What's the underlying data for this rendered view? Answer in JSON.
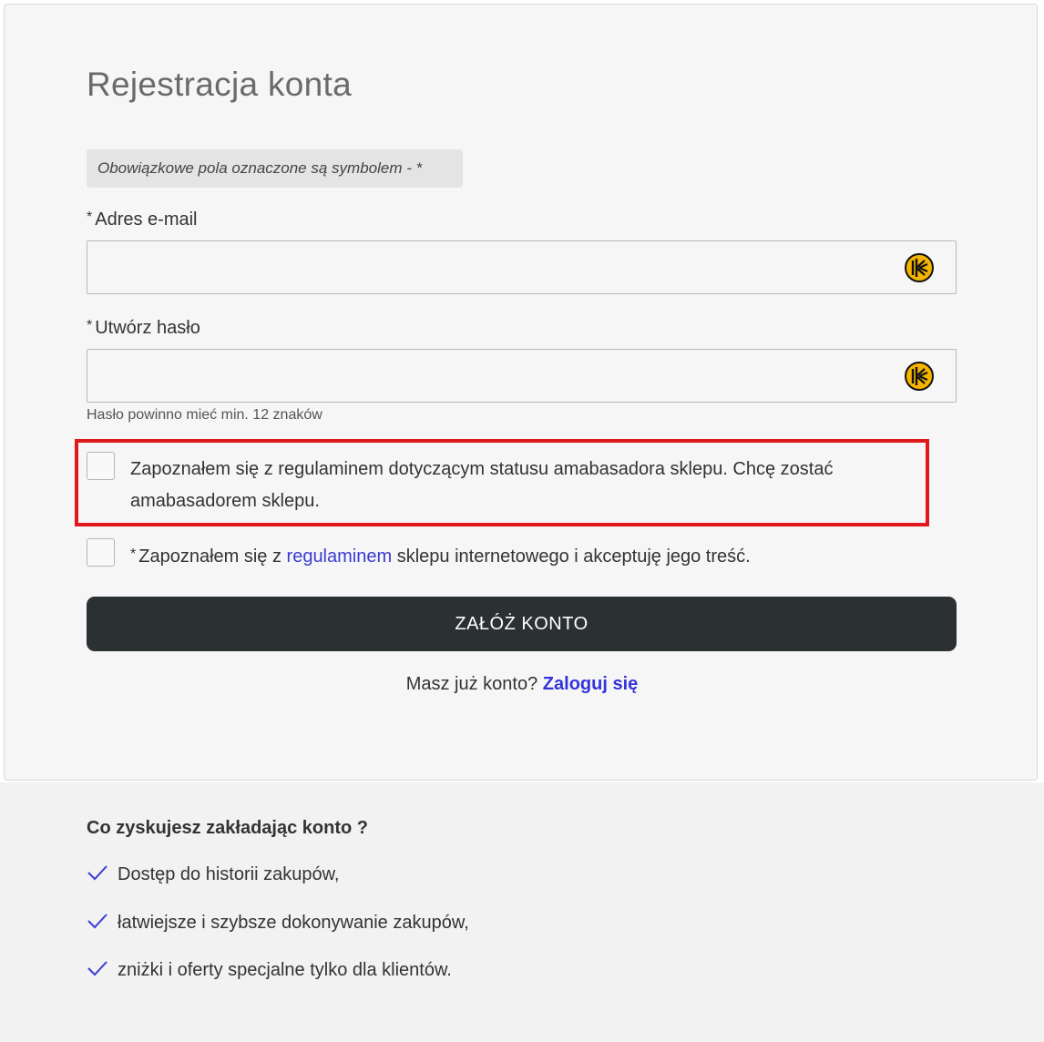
{
  "form": {
    "title": "Rejestracja konta",
    "notice": "Obowiązkowe pola oznaczone są symbolem - *",
    "required_mark": "*",
    "email_label": "Adres e-mail",
    "email_value": "",
    "password_label": "Utwórz hasło",
    "password_value": "",
    "password_hint": "Hasło powinno mieć min. 12 znaków",
    "ambassador_text": "Zapoznałem się z regulaminem dotyczącym statusu amabasadora sklepu. Chcę zostać amabasadorem sklepu.",
    "ambassador_checked": false,
    "terms_prefix": "Zapoznałem się z ",
    "terms_link": "regulaminem",
    "terms_suffix": " sklepu internetowego i akceptuję jego treść.",
    "terms_checked": false,
    "submit_label": "ZAŁÓŻ KONTO",
    "login_prompt": "Masz już konto?",
    "login_link": "Zaloguj się"
  },
  "benefits": {
    "title": "Co zyskujesz zakładając konto ?",
    "items": [
      "Dostęp do historii zakupów,",
      "łatwiejsze i szybsze dokonywanie zakupów,",
      "zniżki i oferty specjalne tylko dla klientów."
    ]
  },
  "colors": {
    "highlight_border": "#e0191c",
    "button_bg": "#2b3133",
    "link": "#3b3bd4",
    "keeper_icon": "#f5b400"
  },
  "icons": {
    "field_icon": "keeper-icon",
    "benefit_icon": "check-icon"
  }
}
